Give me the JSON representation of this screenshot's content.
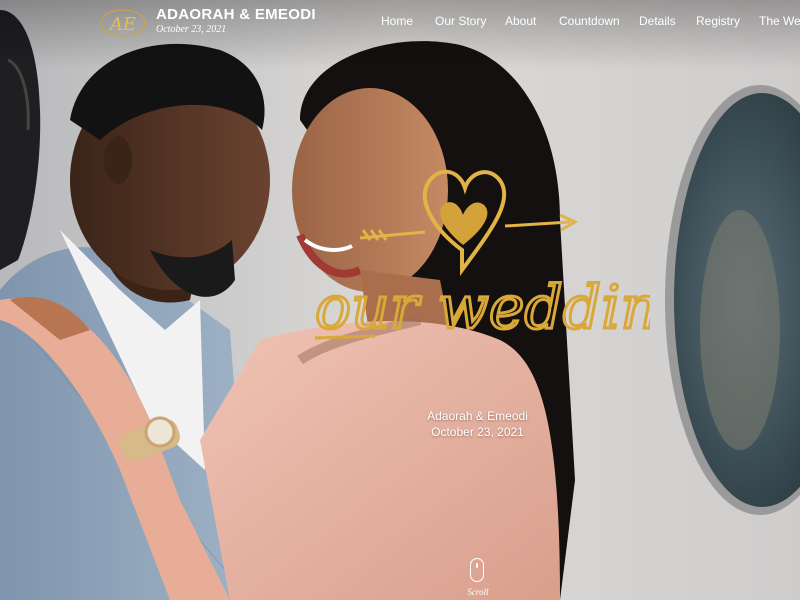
{
  "header": {
    "brand_title": "ADAORAH & EMEODI",
    "brand_date": "October 23, 2021",
    "logo_initials": "AE"
  },
  "nav": {
    "items": [
      {
        "label": "Home"
      },
      {
        "label": "Our Story"
      },
      {
        "label": "About"
      },
      {
        "label": "Countdown"
      },
      {
        "label": "Details"
      },
      {
        "label": "Registry"
      },
      {
        "label": "The Wed"
      }
    ]
  },
  "hero": {
    "names": "Adaorah & Emeodi",
    "date": "October 23, 2021",
    "scroll_label": "Scroll",
    "photo_alt": "couple-engagement-photo",
    "overlay_art": "our-wedding-heart-arrow-gold-glitter"
  },
  "colors": {
    "gold": "#d4a23a",
    "nav_text": "#ffffff",
    "blush_dress": "#e8b5a6"
  }
}
